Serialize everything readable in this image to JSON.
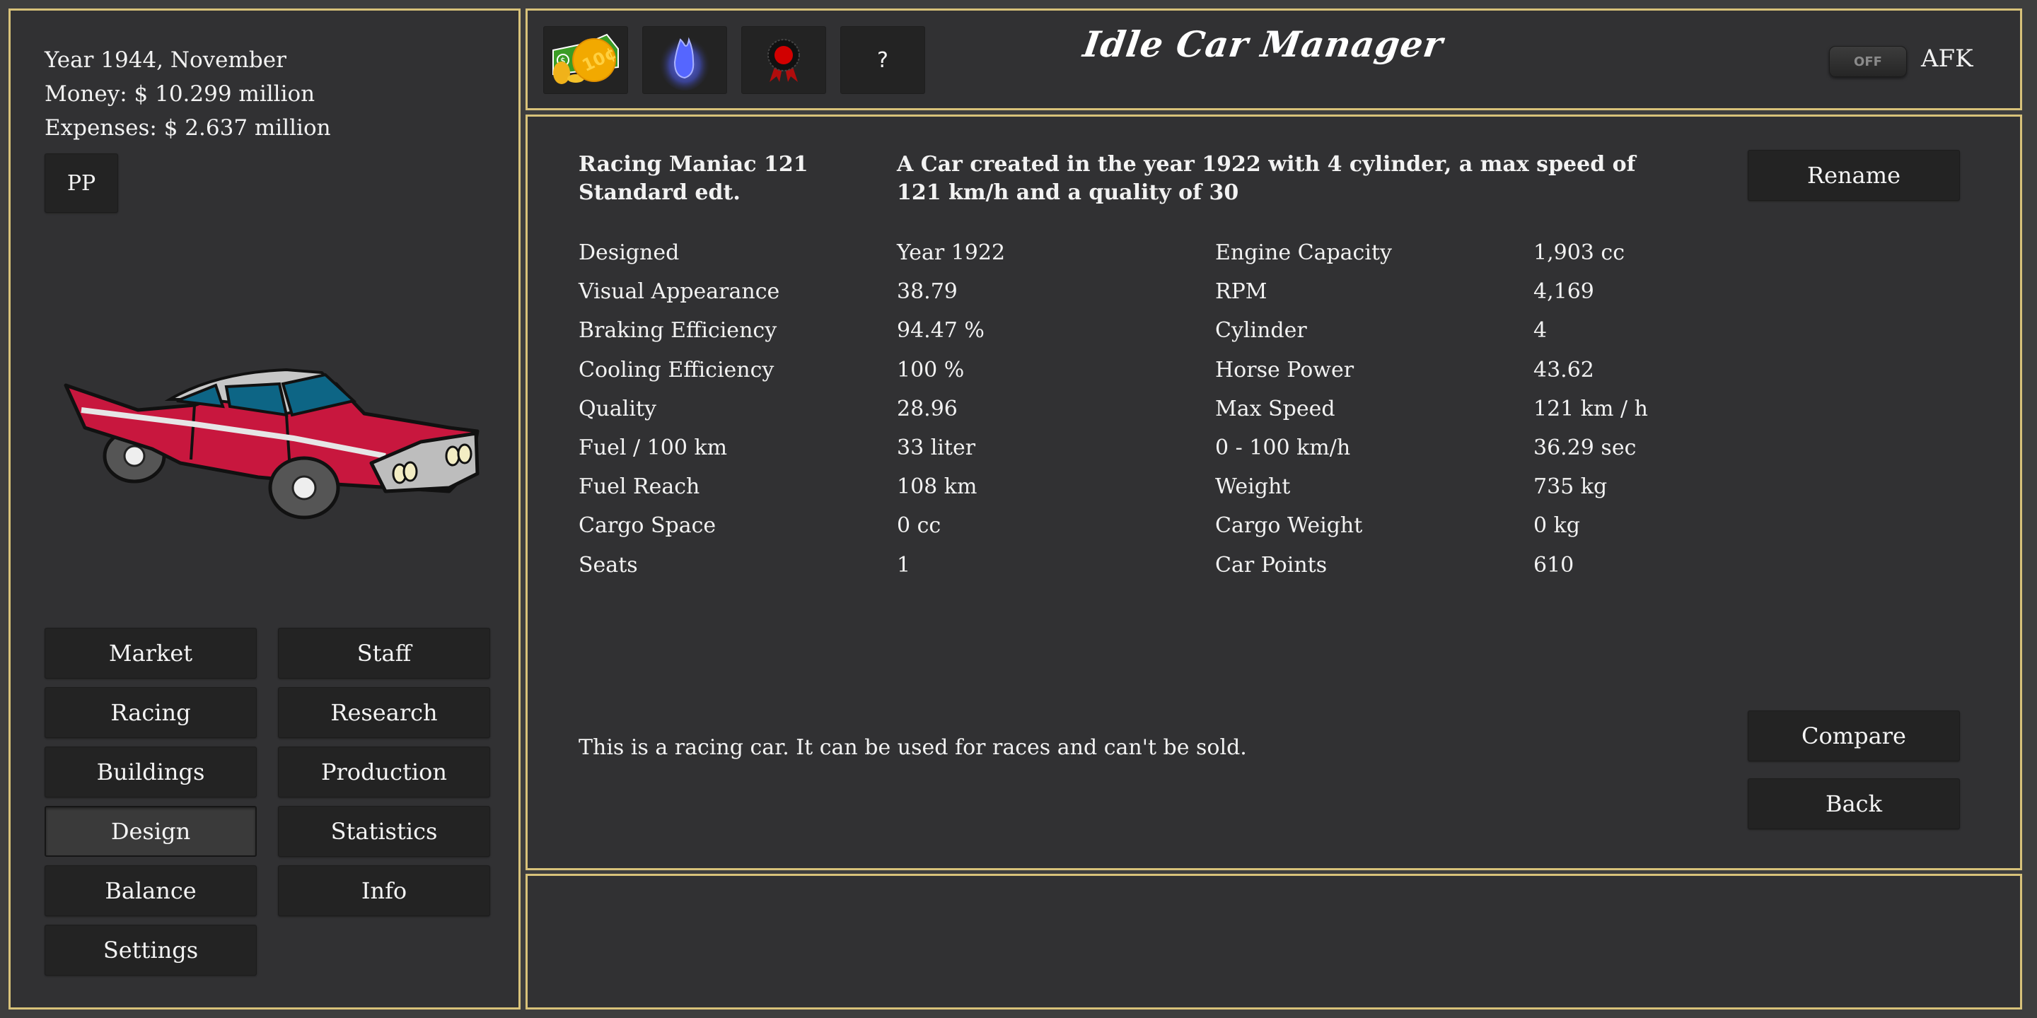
{
  "status": {
    "date": "Year 1944, November",
    "money": "Money: $ 10.299 million",
    "expenses": "Expenses: $ 2.637 million"
  },
  "pp_button": "PP",
  "car_image": "red-classic-car-icon",
  "nav": {
    "items": [
      {
        "label": "Market",
        "active": false
      },
      {
        "label": "Staff",
        "active": false
      },
      {
        "label": "Racing",
        "active": false
      },
      {
        "label": "Research",
        "active": false
      },
      {
        "label": "Buildings",
        "active": false
      },
      {
        "label": "Production",
        "active": false
      },
      {
        "label": "Design",
        "active": true
      },
      {
        "label": "Statistics",
        "active": false
      },
      {
        "label": "Balance",
        "active": false
      },
      {
        "label": "Info",
        "active": false
      },
      {
        "label": "Settings",
        "active": false
      }
    ]
  },
  "top_bar": {
    "icons": [
      "money-coin-icon",
      "blue-flame-icon",
      "award-rosette-icon",
      "help-icon"
    ],
    "help_label": "?",
    "title": "Idle Car Manager",
    "afk_toggle_state": "OFF",
    "afk_label": "AFK"
  },
  "car": {
    "name": "Racing Maniac 121 Standard edt.",
    "description": "A Car created in the year 1922 with 4 cylinder, a max speed of 121 km/h and a quality of 30",
    "stats_left": [
      {
        "label": "Designed",
        "value": "Year 1922"
      },
      {
        "label": "Visual Appearance",
        "value": "38.79"
      },
      {
        "label": "Braking Efficiency",
        "value": "94.47 %"
      },
      {
        "label": "Cooling Efficiency",
        "value": "100 %"
      },
      {
        "label": "Quality",
        "value": "28.96"
      },
      {
        "label": "Fuel / 100 km",
        "value": "33 liter"
      },
      {
        "label": "Fuel Reach",
        "value": "108 km"
      },
      {
        "label": "Cargo Space",
        "value": "0 cc"
      },
      {
        "label": "Seats",
        "value": "1"
      }
    ],
    "stats_right": [
      {
        "label": "Engine Capacity",
        "value": "1,903 cc"
      },
      {
        "label": "RPM",
        "value": "4,169"
      },
      {
        "label": "Cylinder",
        "value": "4"
      },
      {
        "label": "Horse Power",
        "value": "43.62"
      },
      {
        "label": "Max Speed",
        "value": "121 km / h"
      },
      {
        "label": "0 - 100 km/h",
        "value": "36.29 sec"
      },
      {
        "label": "Weight",
        "value": "735 kg"
      },
      {
        "label": "Cargo Weight",
        "value": "0 kg"
      },
      {
        "label": "Car Points",
        "value": "610"
      }
    ],
    "note": "This is a racing car. It can be used for races and can't be sold."
  },
  "actions": {
    "rename": "Rename",
    "compare": "Compare",
    "back": "Back"
  },
  "colors": {
    "panel_border": "#d8c27a",
    "panel_bg": "#313133",
    "page_bg": "#3e3e3e",
    "button_bg": "#232323",
    "active_button_bg": "#3a3a3a"
  }
}
